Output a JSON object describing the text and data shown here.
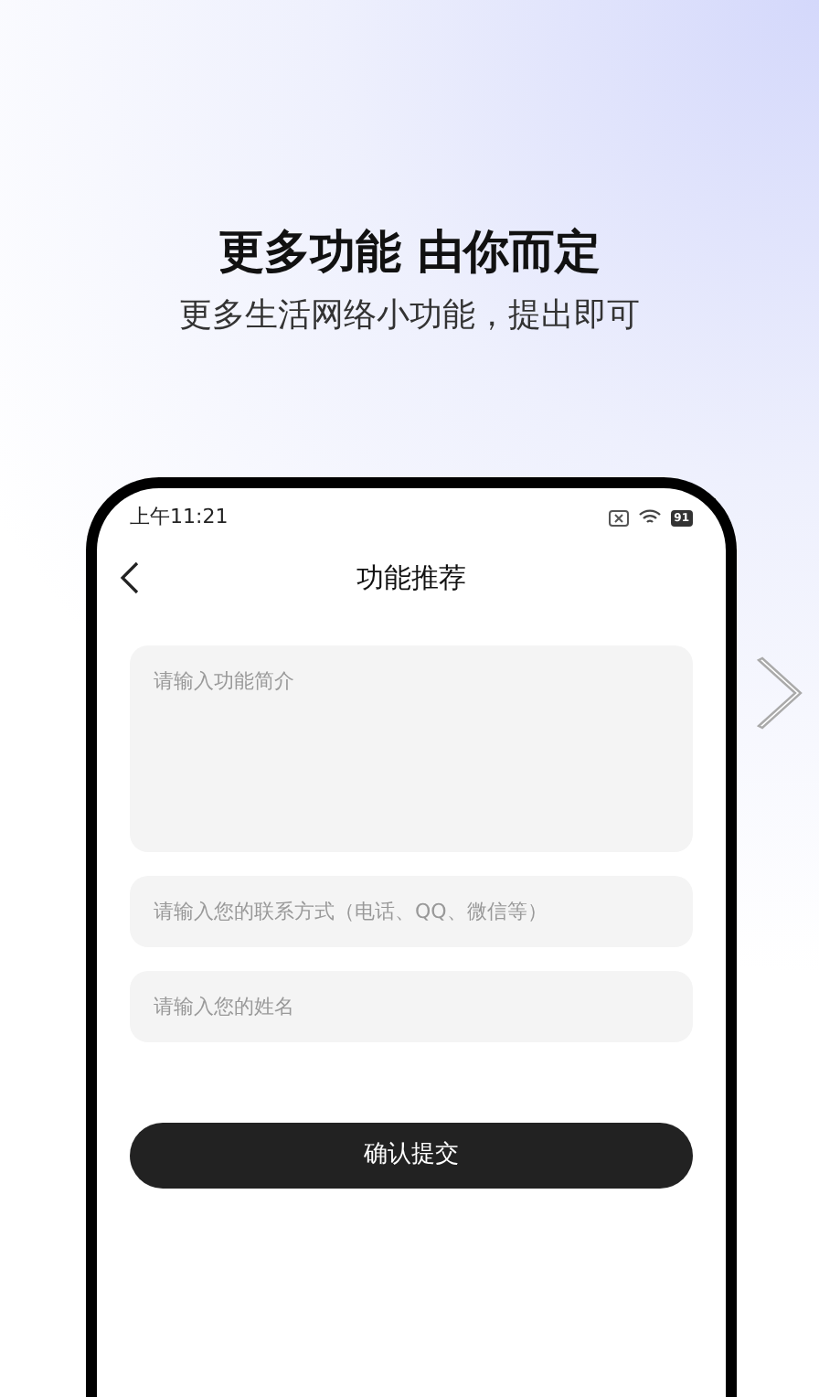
{
  "headline": "更多功能 由你而定",
  "subtitle": "更多生活网络小功能，提出即可",
  "status_bar": {
    "time": "上午11:21",
    "battery": "91"
  },
  "nav": {
    "title": "功能推荐"
  },
  "fields": [
    {
      "kind": "textarea",
      "placeholder": "请输入功能简介"
    },
    {
      "kind": "input",
      "placeholder": "请输入您的联系方式（电话、QQ、微信等）"
    },
    {
      "kind": "input",
      "placeholder": "请输入您的姓名"
    }
  ],
  "submit": "确认提交"
}
